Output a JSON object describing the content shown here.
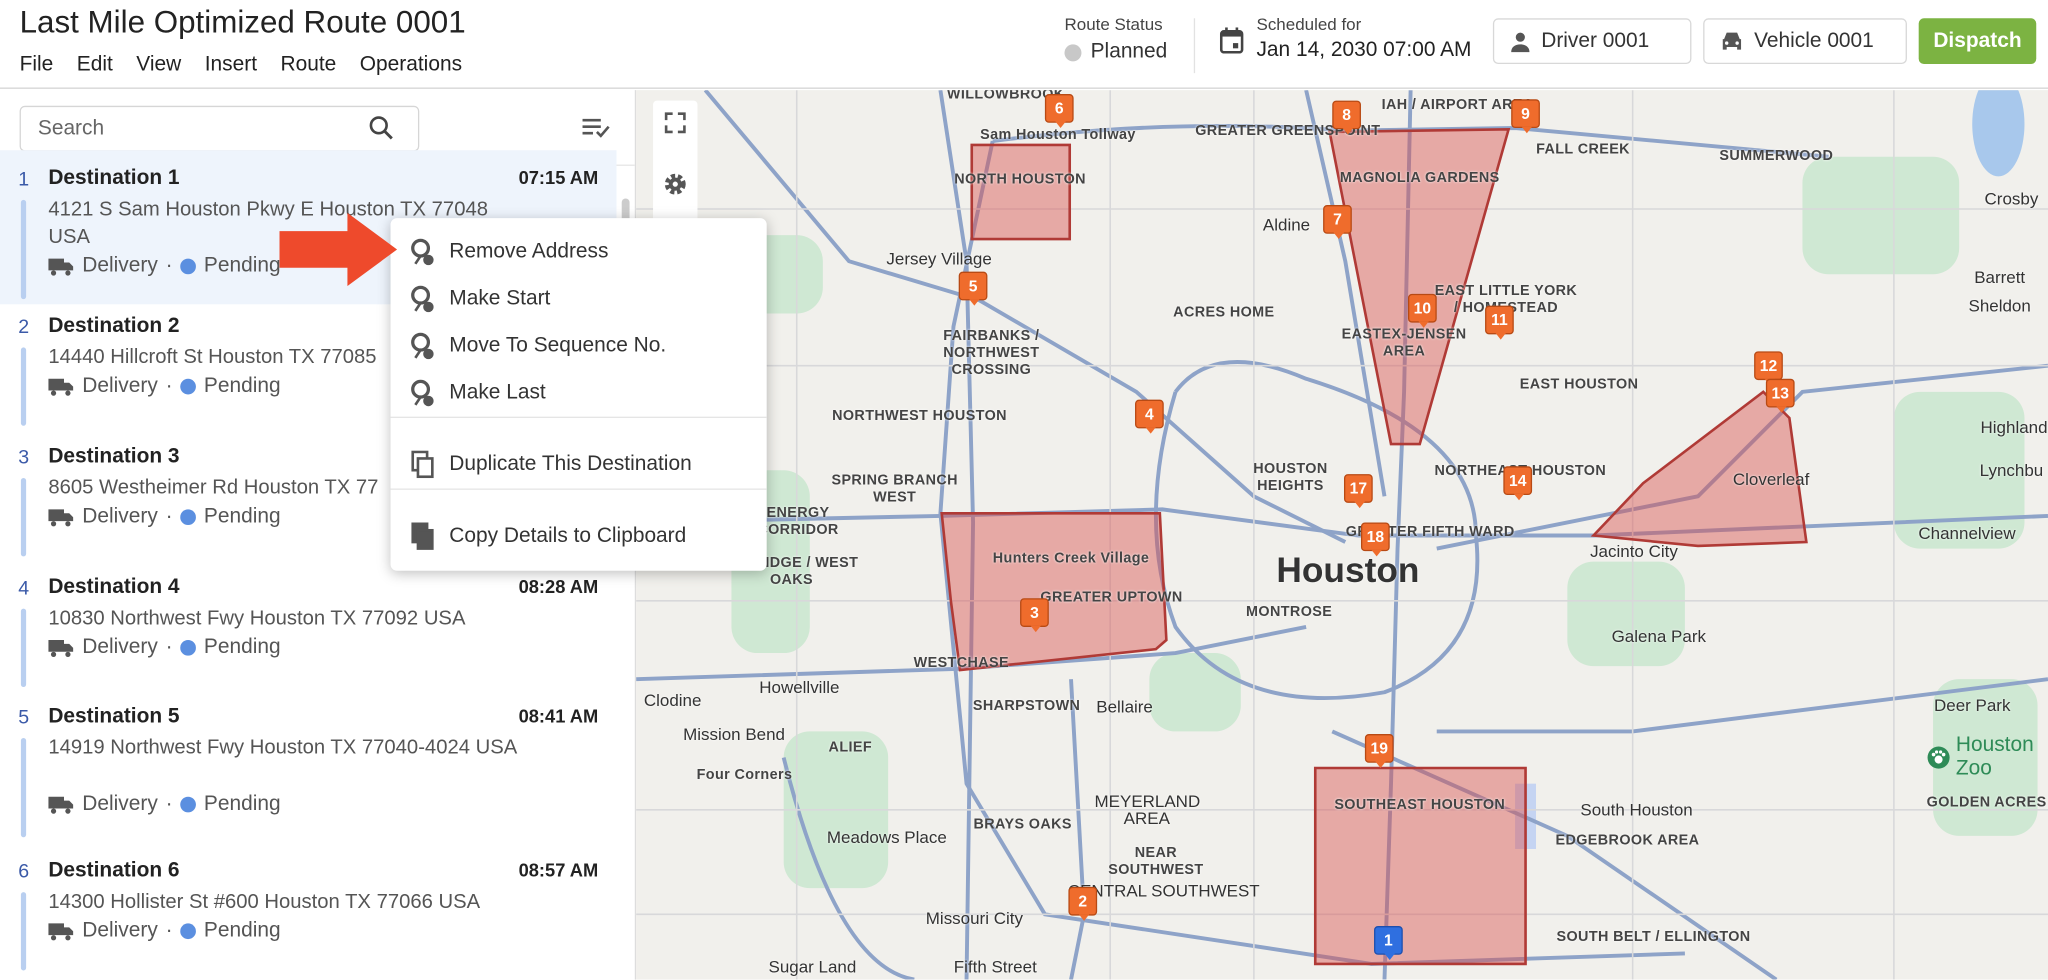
{
  "header": {
    "title": "Last Mile Optimized Route 0001",
    "menu": [
      "File",
      "Edit",
      "View",
      "Insert",
      "Route",
      "Operations"
    ],
    "route_status_label": "Route Status",
    "route_status": "Planned",
    "route_status_color": "#c8c8c8",
    "scheduled_label": "Scheduled for",
    "scheduled_value": "Jan 14, 2030 07:00 AM",
    "driver": "Driver 0001",
    "vehicle": "Vehicle 0001",
    "dispatch": "Dispatch",
    "accent": "#7cb342"
  },
  "sidebar": {
    "search_placeholder": "Search",
    "destinations": [
      {
        "num": "1",
        "name": "Destination 1",
        "time": "07:15 AM",
        "address": "4121 S Sam Houston Pkwy E Houston TX 77048 USA",
        "type": "Delivery",
        "status": "Pending"
      },
      {
        "num": "2",
        "name": "Destination 2",
        "time": "",
        "address": "14440 Hillcroft St Houston TX 77085",
        "type": "Delivery",
        "status": "Pending"
      },
      {
        "num": "3",
        "name": "Destination 3",
        "time": "",
        "address": "8605 Westheimer Rd Houston TX 77",
        "type": "Delivery",
        "status": "Pending"
      },
      {
        "num": "4",
        "name": "Destination 4",
        "time": "08:28 AM",
        "address": "10830 Northwest Fwy Houston TX 77092 USA",
        "type": "Delivery",
        "status": "Pending"
      },
      {
        "num": "5",
        "name": "Destination 5",
        "time": "08:41 AM",
        "address": "14919 Northwest Fwy Houston TX 77040-4024 USA",
        "type": "Delivery",
        "status": "Pending"
      },
      {
        "num": "6",
        "name": "Destination 6",
        "time": "08:57 AM",
        "address": "14300 Hollister St #600 Houston TX 77066 USA",
        "type": "Delivery",
        "status": "Pending"
      }
    ]
  },
  "context_menu": {
    "items": [
      {
        "label": "Remove Address",
        "icon": "pin-remove-icon"
      },
      {
        "label": "Make Start",
        "icon": "pin-start-icon"
      },
      {
        "label": "Move To Sequence No.",
        "icon": "pin-move-icon"
      },
      {
        "label": "Make Last",
        "icon": "pin-last-icon"
      },
      {
        "label": "Duplicate This Destination",
        "icon": "duplicate-icon"
      },
      {
        "label": "Copy Details to Clipboard",
        "icon": "copy-icon"
      }
    ]
  },
  "map": {
    "markers": [
      "1",
      "2",
      "3",
      "4",
      "5",
      "6",
      "7",
      "8",
      "9",
      "10",
      "11",
      "12",
      "13",
      "14",
      "17",
      "18",
      "19"
    ],
    "labels": [
      "WILLOWBROOK",
      "Sam Houston Tollway",
      "NORTH HOUSTON",
      "IAH / AIRPORT AREA",
      "GREATER GREENSPOINT",
      "MAGNOLIA GARDENS",
      "FALL CREEK",
      "SUMMERWOOD",
      "Crosby",
      "Aldine",
      "Jersey Village",
      "ACRES HOME",
      "EAST LITTLE YORK / HOMESTEAD",
      "Barrett",
      "Sheldon",
      "FAIRBANKS / NORTHWEST CROSSING",
      "EASTEX-JENSEN AREA",
      "NORTHWEST HOUSTON",
      "EAST HOUSTON",
      "Highland",
      "HOUSTON HEIGHTS",
      "NORTHEAST HOUSTON",
      "SPRING BRANCH WEST",
      "Cloverleaf",
      "Lynchbu",
      "ENERGY CORRIDOR",
      "Hunters Creek Village",
      "GREATER FIFTH WARD",
      "Channelview",
      "Houston",
      "Jacinto City",
      "ELDRIDGE / WEST OAKS",
      "GREATER UPTOWN",
      "MONTROSE",
      "Galena Park",
      "Howellville",
      "WESTCHASE",
      "Houston Zoo",
      "Clodine",
      "SHARPSTOWN",
      "Bellaire",
      "Deer Park",
      "Mission Bend",
      "ALIEF",
      "MEYERLAND AREA",
      "SOUTHEAST HOUSTON",
      "Four Corners",
      "NEAR SOUTHWEST",
      "South Houston",
      "GOLDEN ACRES",
      "Meadows Place",
      "BRAYS OAKS",
      "EDGEBROOK AREA",
      "CENTRAL SOUTHWEST",
      "SOUTH BELT / ELLINGTON",
      "Missouri City",
      "Sugar Land",
      "Fifth Street"
    ],
    "marker_color": "#ef6c2c",
    "start_color": "#2f6fe0",
    "zone_color": "#d9534f"
  }
}
